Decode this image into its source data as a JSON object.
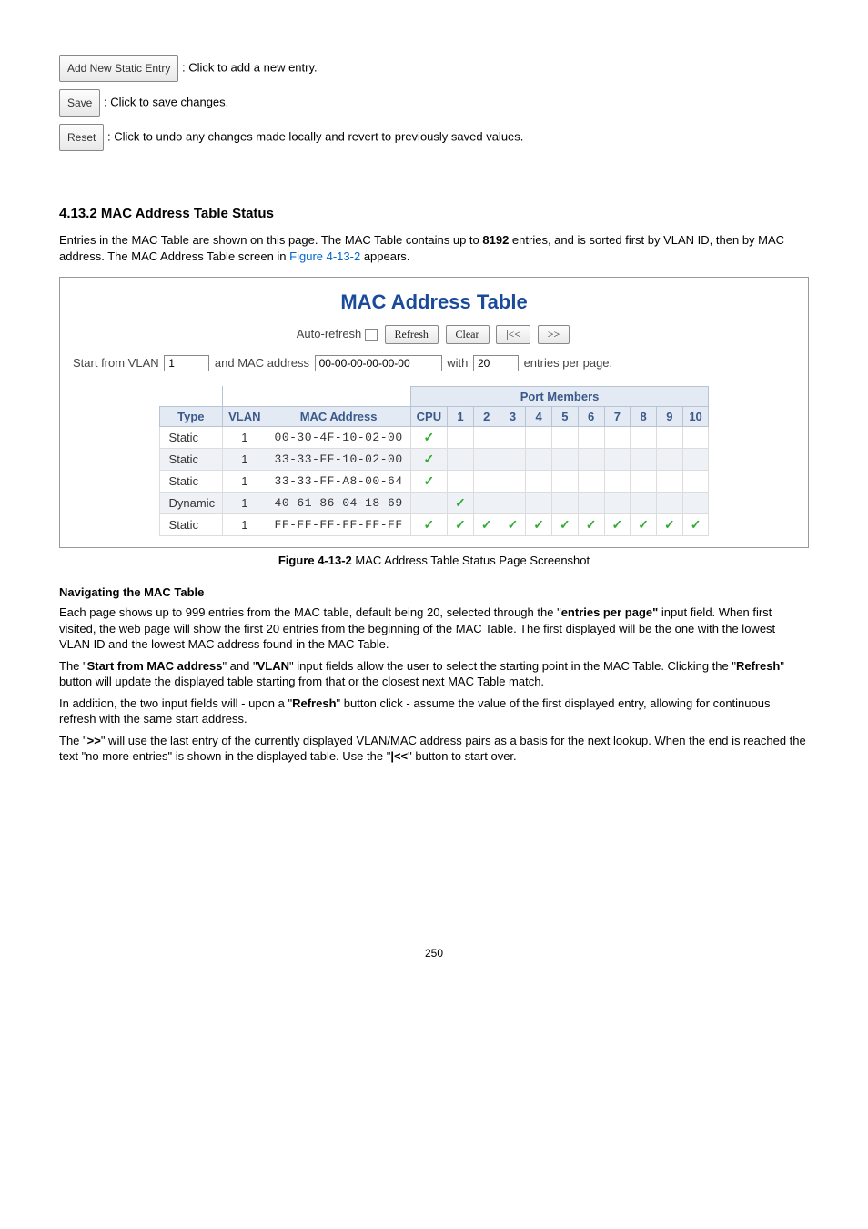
{
  "buttons_doc": {
    "add_new_static": {
      "label": "Add New Static Entry",
      "desc": " : Click to add a new entry."
    },
    "save": {
      "label": "Save",
      "desc": ": Click to save changes."
    },
    "reset": {
      "label": "Reset",
      "desc": ": Click to undo any changes made locally and revert to previously saved values."
    }
  },
  "section_title": "4.13.2 MAC Address Table Status",
  "intro_1a": "Entries in the MAC Table are shown on this page. The MAC Table contains up to ",
  "intro_1b": "8192",
  "intro_1c": " entries, and is sorted first by VLAN ID, then by MAC address. The MAC Address Table screen in ",
  "intro_link": "Figure 4-13-2",
  "intro_1d": " appears.",
  "screenshot": {
    "title": "MAC Address Table",
    "auto_refresh": "Auto-refresh",
    "refresh_btn": "Refresh",
    "clear_btn": "Clear",
    "prev_btn": "|<<",
    "next_btn": ">>",
    "start_vlan_label": "Start from VLAN",
    "vlan_value": "1",
    "and_mac_label": "and MAC address",
    "mac_value": "00-00-00-00-00-00",
    "with_label": "with",
    "with_value": "20",
    "entries_label": "entries per page.",
    "headers": {
      "type": "Type",
      "vlan": "VLAN",
      "mac": "MAC Address",
      "port_members": "Port Members",
      "ports": [
        "CPU",
        "1",
        "2",
        "3",
        "4",
        "5",
        "6",
        "7",
        "8",
        "9",
        "10"
      ]
    },
    "rows": [
      {
        "type": "Static",
        "vlan": "1",
        "mac": "00-30-4F-10-02-00",
        "checks": [
          true,
          false,
          false,
          false,
          false,
          false,
          false,
          false,
          false,
          false,
          false
        ]
      },
      {
        "type": "Static",
        "vlan": "1",
        "mac": "33-33-FF-10-02-00",
        "checks": [
          true,
          false,
          false,
          false,
          false,
          false,
          false,
          false,
          false,
          false,
          false
        ]
      },
      {
        "type": "Static",
        "vlan": "1",
        "mac": "33-33-FF-A8-00-64",
        "checks": [
          true,
          false,
          false,
          false,
          false,
          false,
          false,
          false,
          false,
          false,
          false
        ]
      },
      {
        "type": "Dynamic",
        "vlan": "1",
        "mac": "40-61-86-04-18-69",
        "checks": [
          false,
          true,
          false,
          false,
          false,
          false,
          false,
          false,
          false,
          false,
          false
        ]
      },
      {
        "type": "Static",
        "vlan": "1",
        "mac": "FF-FF-FF-FF-FF-FF",
        "checks": [
          true,
          true,
          true,
          true,
          true,
          true,
          true,
          true,
          true,
          true,
          true
        ]
      }
    ]
  },
  "caption_bold": "Figure 4-13-2",
  "caption_rest": " MAC Address Table Status Page Screenshot",
  "nav_title": "Navigating the MAC Table",
  "nav_p1a": "Each page shows up to 999 entries from the MAC table, default being 20, selected through the \"",
  "nav_p1b": "entries per page\"",
  "nav_p1c": " input field. When first visited, the web page will show the first 20 entries from the beginning of the MAC Table. The first displayed will be the one with the lowest VLAN ID and the lowest MAC address found in the MAC Table.",
  "nav_p2a": "The \"",
  "nav_p2b": "Start from MAC address",
  "nav_p2c": "\" and \"",
  "nav_p2d": "VLAN",
  "nav_p2e": "\" input fields allow the user to select the starting point in the MAC Table. Clicking the \"",
  "nav_p2f": "Refresh",
  "nav_p2g": "\" button will update the displayed table starting from that or the closest next MAC Table match.",
  "nav_p3a": "In addition, the two input fields will - upon a \"",
  "nav_p3b": "Refresh",
  "nav_p3c": "\" button click - assume the value of the first displayed entry, allowing for continuous refresh with the same start address.",
  "nav_p4a": "The \"",
  "nav_p4b": ">>",
  "nav_p4c": "\" will use the last entry of the currently displayed VLAN/MAC address pairs as a basis for the next lookup. When the end is reached the text \"no more entries\" is shown in the displayed table. Use the \"",
  "nav_p4d": "|<<",
  "nav_p4e": "\" button to start over.",
  "page_no": "250"
}
